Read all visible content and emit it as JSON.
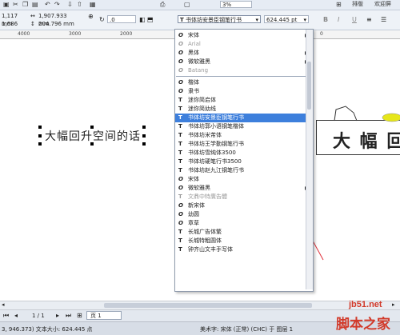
{
  "toolbar": {
    "zoom": "3%",
    "right_items": [
      "排版",
      "欢迎屏"
    ]
  },
  "propbar": {
    "x_value": "1,117 mm",
    "y_value": "1,686 mm",
    "w_value": "1,907.933 mm",
    "h_value": "204.796 mm",
    "angle_value": ".0",
    "font_name": "书体坊安景臣钢笔行书",
    "font_size": "624.445 pt"
  },
  "ruler": {
    "ticks": [
      "4000",
      "3000",
      "2000"
    ],
    "tick_right": "0"
  },
  "canvas": {
    "selected_text": "大幅回升空间的话",
    "preview_text": "大 幅 回"
  },
  "font_list": {
    "items": [
      {
        "icon": "O",
        "name": "宋体",
        "style": "normal",
        "arrow": "▶"
      },
      {
        "icon": "O",
        "name": "Arial",
        "style": "grey",
        "arrow": ""
      },
      {
        "icon": "O",
        "name": "黑体",
        "style": "normal",
        "arrow": "▶"
      },
      {
        "icon": "O",
        "name": "微软雅黑",
        "style": "normal",
        "arrow": "▶"
      },
      {
        "icon": "O",
        "name": "Batang",
        "style": "grey",
        "arrow": ""
      },
      {
        "icon": "O",
        "name": "楷体",
        "style": "normal",
        "arrow": ""
      },
      {
        "icon": "O",
        "name": "隶书",
        "style": "normal",
        "arrow": ""
      },
      {
        "icon": "T",
        "name": "迷你简启体",
        "style": "normal",
        "arrow": ""
      },
      {
        "icon": "T",
        "name": "迷你简幼线",
        "style": "normal",
        "arrow": ""
      },
      {
        "icon": "T",
        "name": "书体坊安景臣钢笔行书",
        "style": "selected",
        "arrow": ""
      },
      {
        "icon": "T",
        "name": "书体坊郭小语钢笔楷体",
        "style": "normal",
        "arrow": ""
      },
      {
        "icon": "T",
        "name": "书体坊米芾体",
        "style": "normal",
        "arrow": ""
      },
      {
        "icon": "T",
        "name": "书体坊王学勤钢笔行书",
        "style": "normal",
        "arrow": ""
      },
      {
        "icon": "T",
        "name": "书体坊雪纯体3500",
        "style": "normal",
        "arrow": ""
      },
      {
        "icon": "T",
        "name": "书体坊硬笔行书3500",
        "style": "normal",
        "arrow": ""
      },
      {
        "icon": "T",
        "name": "书体坊赵九江钢笔行书",
        "style": "normal",
        "arrow": ""
      },
      {
        "icon": "O",
        "name": "宋体",
        "style": "normal",
        "arrow": ""
      },
      {
        "icon": "O",
        "name": "微软雅黑",
        "style": "normal",
        "arrow": "▶"
      },
      {
        "icon": "T",
        "name": "文鼎中特廣告體",
        "style": "grey",
        "arrow": ""
      },
      {
        "icon": "O",
        "name": "新宋体",
        "style": "normal",
        "arrow": ""
      },
      {
        "icon": "O",
        "name": "幼圆",
        "style": "normal",
        "arrow": ""
      },
      {
        "icon": "O",
        "name": "章草",
        "style": "normal",
        "arrow": ""
      },
      {
        "icon": "T",
        "name": "长城广告体繁",
        "style": "normal",
        "arrow": ""
      },
      {
        "icon": "T",
        "name": "长城特粗圆体",
        "style": "normal",
        "arrow": ""
      },
      {
        "icon": "T",
        "name": "钟齐山文丰手写体",
        "style": "normal",
        "arrow": ""
      }
    ]
  },
  "pagebar": {
    "page_count": "1 / 1",
    "page_tab": "页 1"
  },
  "statusbar": {
    "left": "3, 946.373) 文本大小: 624.445 点",
    "mid": "美术字: 宋体 (正常) (CHC) 于 图层 1",
    "right_label": "图层"
  },
  "watermark": {
    "line1": "jb51.net",
    "line2": "脚本之家"
  },
  "colors": {
    "selection": "#3d7fdc",
    "arrow": "#e0303a",
    "watermark": "#d23a2a"
  }
}
